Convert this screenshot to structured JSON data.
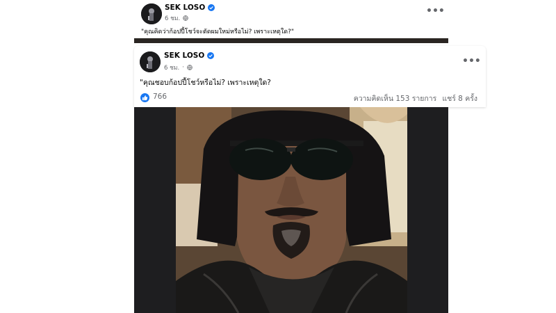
{
  "back_post": {
    "author": "SEK LOSO",
    "time": "6 ชม.",
    "text": "\"คุณคิดว่าก้อปปี้โชว์จะตัดผมใหม่หรือไม่? เพราะเหตุใด?\""
  },
  "front_post": {
    "author": "SEK LOSO",
    "time": "6 ชม.",
    "separator": "·",
    "text": "\"คุณชอบก้อปปี้โชว์หรือไม่? เพราะเหตุใด?",
    "like_count": "766",
    "comments": "ความคิดเห็น 153 รายการ",
    "shares": "แชร์ 8 ครั้ง"
  },
  "menu_glyph": "•••",
  "icons": {
    "verified": "verified-badge-icon",
    "globe": "globe-icon",
    "like": "like-icon",
    "menu": "more-options-icon"
  },
  "colors": {
    "brand_blue": "#1877f2",
    "secondary_text": "#65676b",
    "primary_text": "#050505"
  }
}
